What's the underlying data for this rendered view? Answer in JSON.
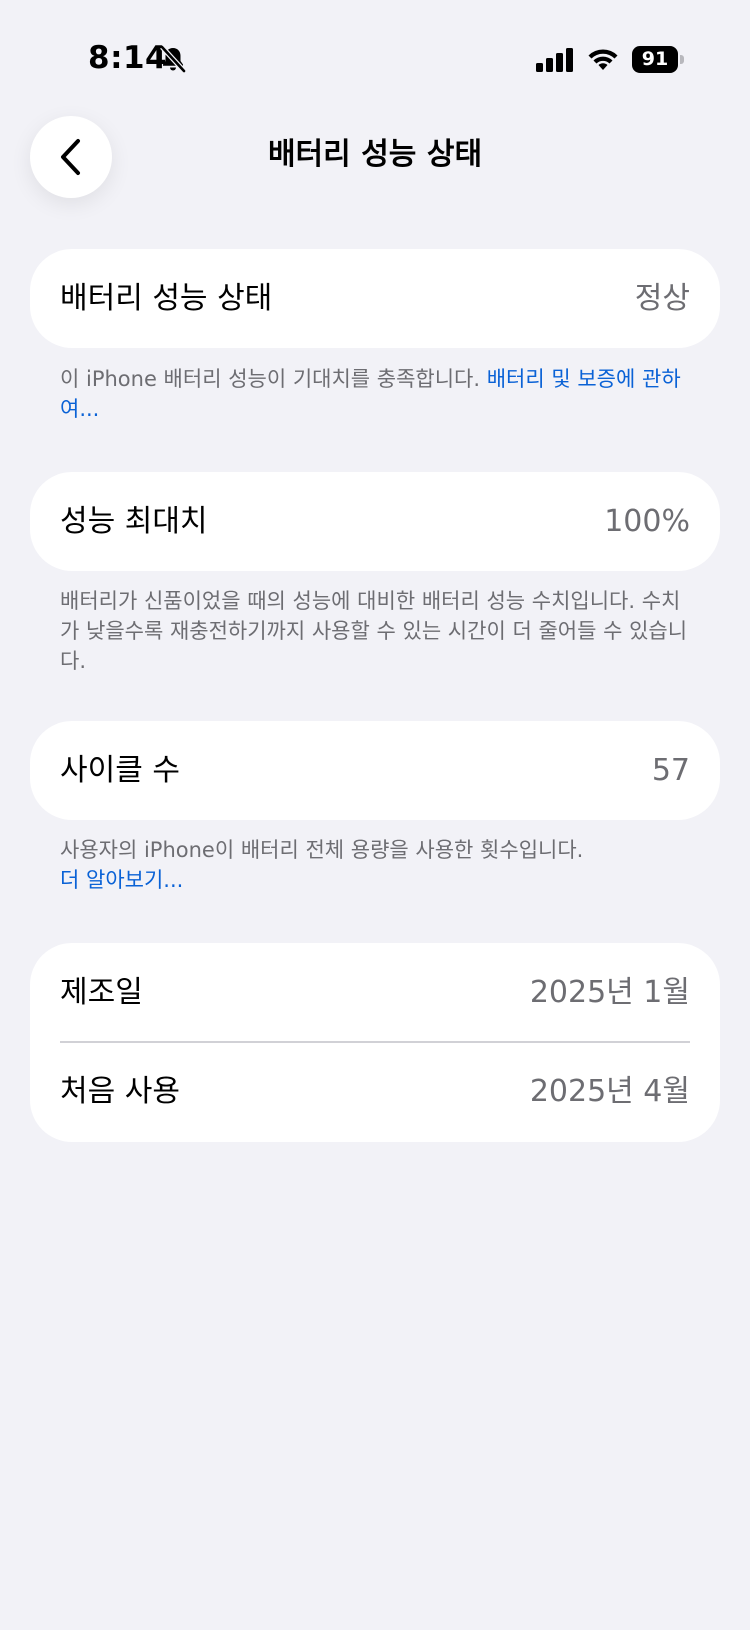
{
  "status_bar": {
    "time": "8:14",
    "silent_icon": "bell-slash-icon",
    "signal_icon": "cellular-signal-icon",
    "wifi_icon": "wifi-icon",
    "battery_level": "91"
  },
  "nav": {
    "back_icon": "chevron-left-icon",
    "title": "배터리 성능 상태"
  },
  "battery_health": {
    "label": "배터리 성능 상태",
    "value": "정상",
    "footnote_text": "이 iPhone 배터리 성능이 기대치를 충족합니다. ",
    "footnote_link": "배터리 및 보증에 관하여..."
  },
  "maximum_capacity": {
    "label": "성능 최대치",
    "value": "100%",
    "footnote_text": "배터리가 신품이었을 때의 성능에 대비한 배터리 성능 수치입니다. 수치가 낮을수록 재충전하기까지 사용할 수 있는 시간이 더 줄어들 수 있습니다."
  },
  "cycle_count": {
    "label": "사이클 수",
    "value": "57",
    "footnote_text": "사용자의 iPhone이 배터리 전체 용량을 사용한 횟수입니다.",
    "footnote_link": "더 알아보기..."
  },
  "dates": {
    "manufacture_label": "제조일",
    "manufacture_value": "2025년 1월",
    "first_use_label": "처음 사용",
    "first_use_value": "2025년 4월"
  },
  "colors": {
    "background": "#f2f2f7",
    "card": "#ffffff",
    "secondary_text": "#6d6d72",
    "link": "#0a62d6"
  }
}
